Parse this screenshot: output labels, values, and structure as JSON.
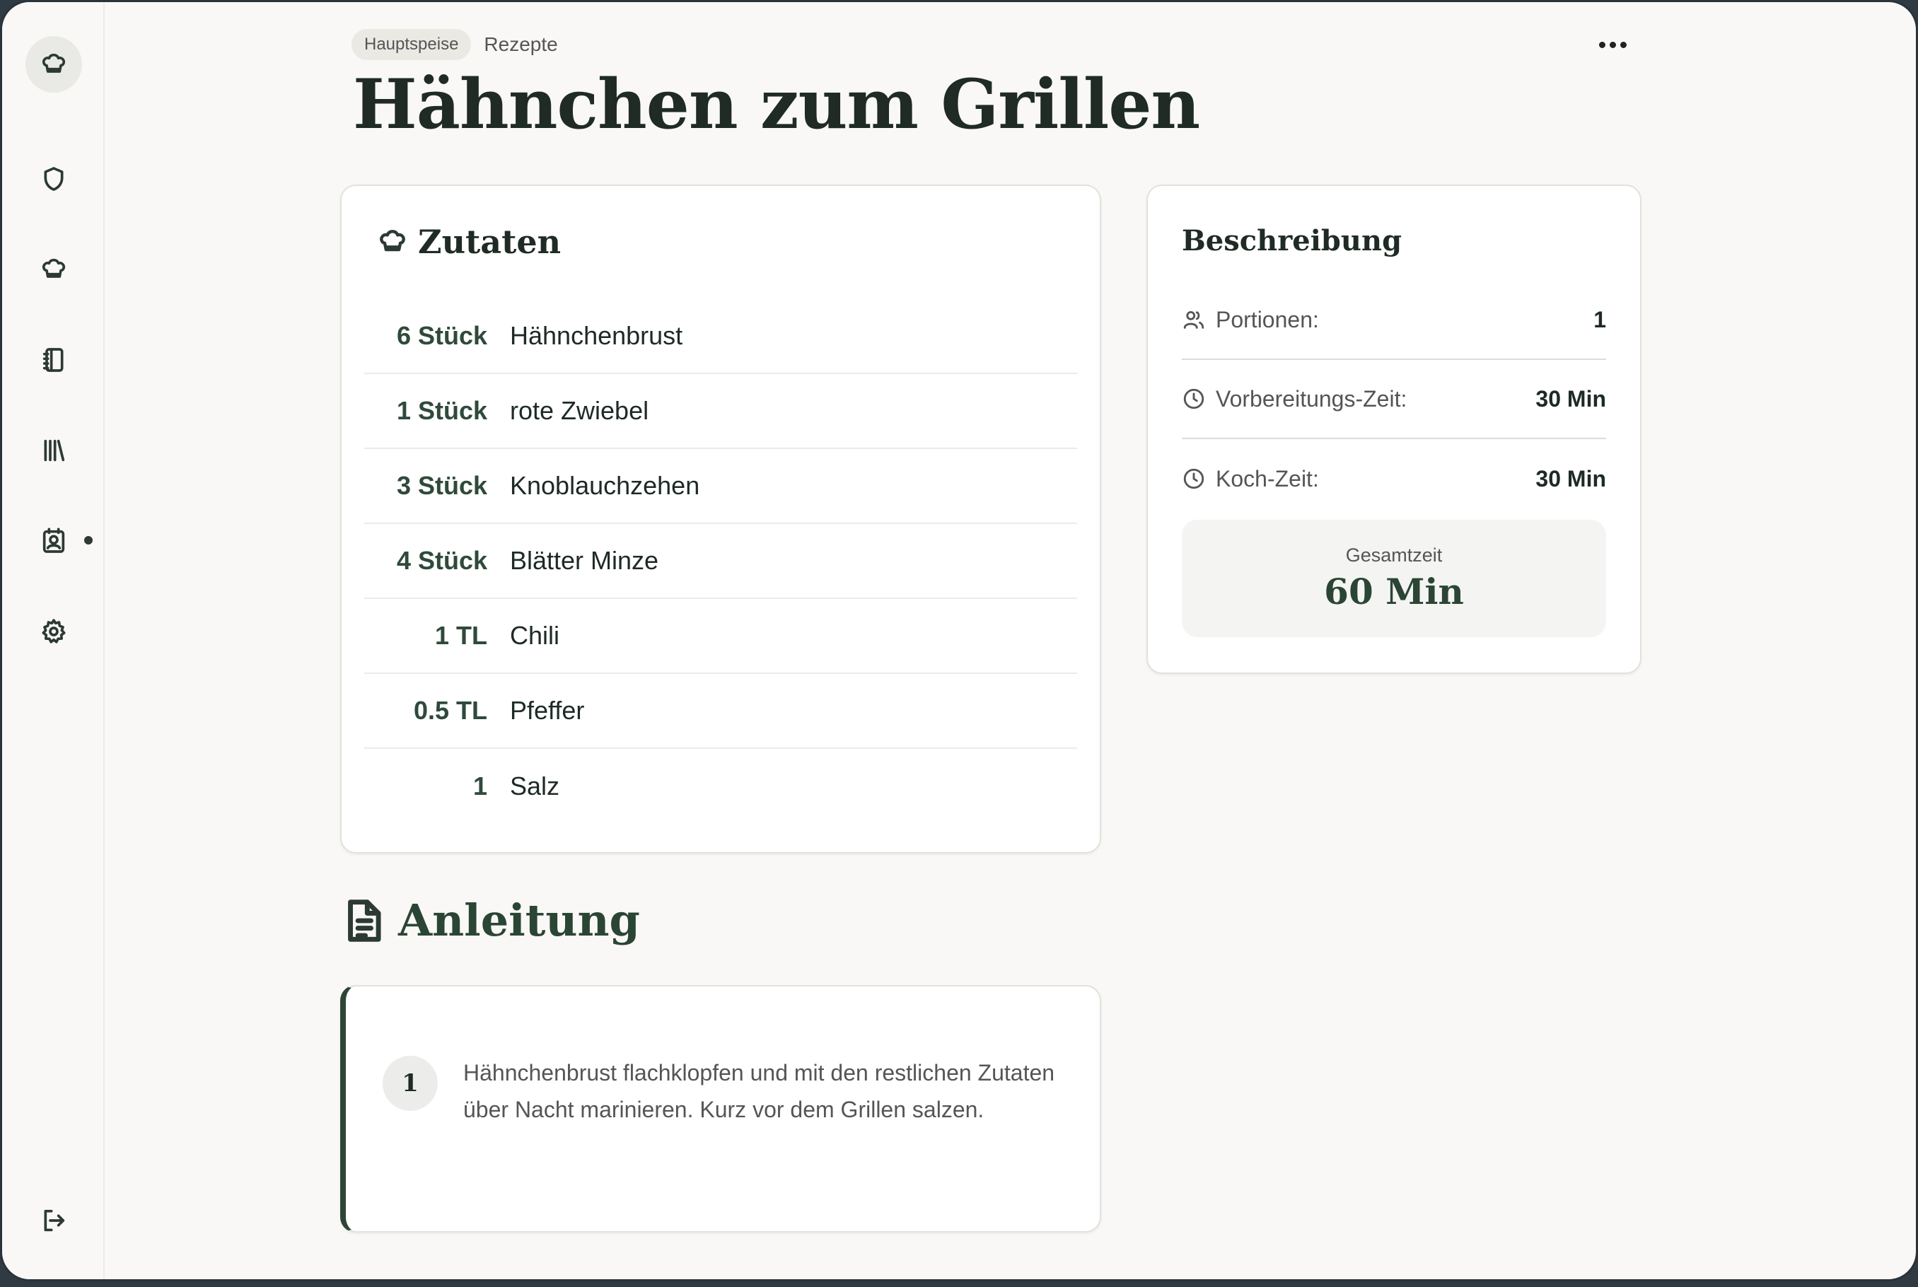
{
  "header": {
    "category_chip": "Hauptspeise",
    "breadcrumb": "Rezepte",
    "title": "Hähnchen zum Grillen"
  },
  "sidebar": {
    "items": [
      {
        "name": "home",
        "icon": "chef-hat-icon",
        "active": true
      },
      {
        "name": "shield",
        "icon": "shield-icon",
        "active": false
      },
      {
        "name": "recipes",
        "icon": "chef-hat-icon",
        "active": false
      },
      {
        "name": "notebook",
        "icon": "notebook-icon",
        "active": false
      },
      {
        "name": "library",
        "icon": "library-icon",
        "active": false
      },
      {
        "name": "contacts",
        "icon": "contact-icon",
        "active": false
      },
      {
        "name": "settings",
        "icon": "gear-icon",
        "active": false
      },
      {
        "name": "logout",
        "icon": "logout-icon",
        "active": false
      }
    ]
  },
  "ingredients": {
    "title": "Zutaten",
    "items": [
      {
        "amount": "6 Stück",
        "name": "Hähnchenbrust"
      },
      {
        "amount": "1 Stück",
        "name": "rote Zwiebel"
      },
      {
        "amount": "3 Stück",
        "name": "Knoblauchzehen"
      },
      {
        "amount": "4 Stück",
        "name": "Blätter Minze"
      },
      {
        "amount": "1 TL",
        "name": "Chili"
      },
      {
        "amount": "0.5 TL",
        "name": "Pfeffer"
      },
      {
        "amount": "1",
        "name": "Salz"
      }
    ]
  },
  "description": {
    "title": "Beschreibung",
    "servings_label": "Portionen:",
    "servings_value": "1",
    "prep_label": "Vorbereitungs-Zeit:",
    "prep_value": "30 Min",
    "cook_label": "Koch-Zeit:",
    "cook_value": "30 Min",
    "total_label": "Gesamtzeit",
    "total_value": "60 Min"
  },
  "instructions": {
    "title": "Anleitung",
    "steps": [
      {
        "number": "1",
        "text": "Hähnchenbrust flachklopfen und mit den restlichen Zutaten über Nacht marinieren. Kurz vor dem Grillen salzen."
      }
    ]
  },
  "colors": {
    "accent": "#2b4535",
    "background": "#f9f8f6",
    "card": "#ffffff"
  }
}
